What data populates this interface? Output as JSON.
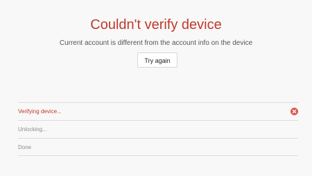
{
  "header": {
    "title": "Couldn't verify device",
    "subtitle": "Current account is different from the account info on the device"
  },
  "actions": {
    "retry_label": "Try again"
  },
  "steps": [
    {
      "label": "Verifying device...",
      "state": "error",
      "icon": "error-x-icon"
    },
    {
      "label": "Unlocking...",
      "state": "pending"
    },
    {
      "label": "Done",
      "state": "pending"
    }
  ],
  "colors": {
    "error": "#c0392b",
    "error_icon": "#e05a4b",
    "muted_text": "#8c8c8c",
    "background": "#f8f8f8"
  }
}
